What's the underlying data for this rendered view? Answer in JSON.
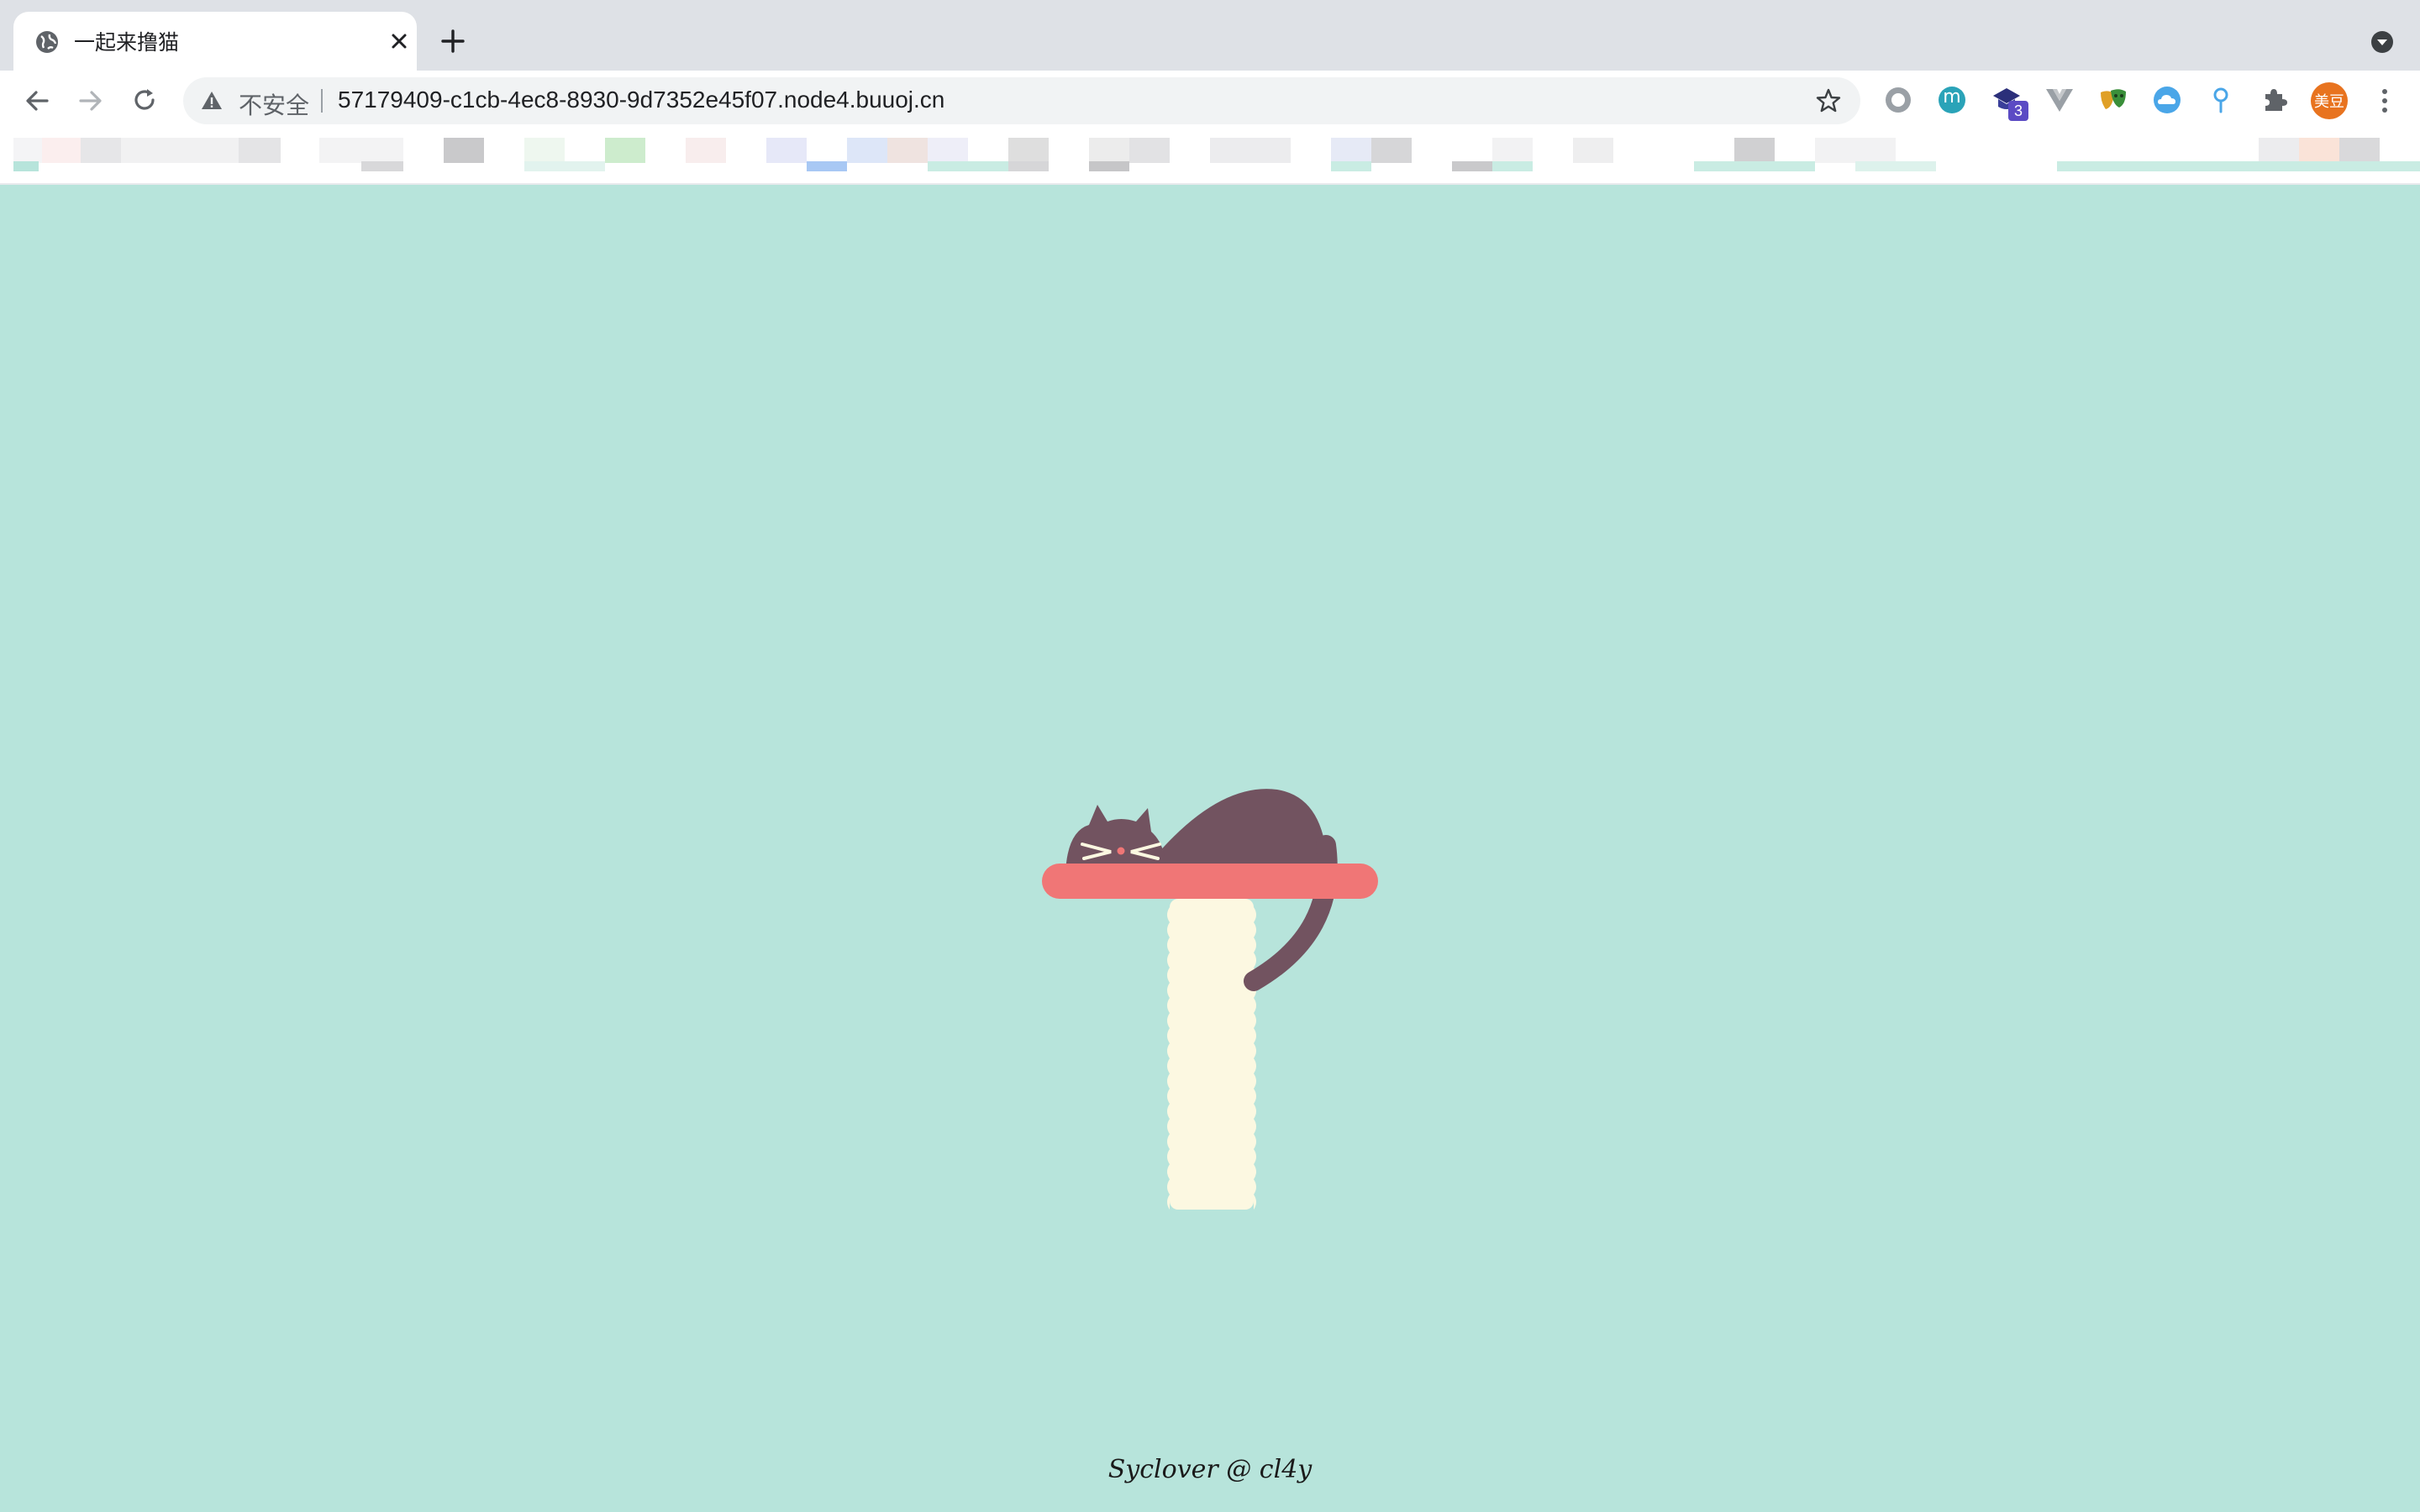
{
  "browser": {
    "tab": {
      "title": "一起来撸猫",
      "favicon": "globe-icon"
    },
    "toolbar": {
      "security_label": "不安全",
      "url": "57179409-c1cb-4ec8-8930-9d7352e45f07.node4.buuoj.cn"
    },
    "extensions": [
      {
        "name": "circle-extension-icon"
      },
      {
        "name": "m-extension-icon",
        "label": "m"
      },
      {
        "name": "graduation-extension-icon",
        "badge": "3"
      },
      {
        "name": "vue-extension-icon"
      },
      {
        "name": "mask-extension-icon"
      },
      {
        "name": "cloud-extension-icon"
      },
      {
        "name": "pin-extension-icon"
      },
      {
        "name": "puzzle-icon"
      }
    ],
    "profile": {
      "label": "美豆",
      "color": "#e8731f"
    }
  },
  "page": {
    "background_color": "#b7e4db",
    "footer": "Syclover @ cl4y",
    "colors": {
      "cat": "#725360",
      "shelf": "#f07676",
      "post": "#fcf8e1"
    }
  }
}
